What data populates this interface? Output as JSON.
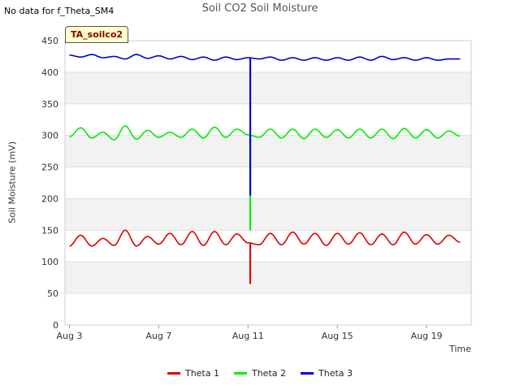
{
  "header": {
    "no_data_text": "No data for f_Theta_SM4",
    "title": "Soil CO2 Soil Moisture",
    "badge": "TA_soilco2"
  },
  "chart_data": {
    "type": "line",
    "title": "Soil CO2 Soil Moisture",
    "xlabel": "Time",
    "ylabel": "Soil Moisture (mV)",
    "xlim": [
      "2023-08-03",
      "2023-08-21"
    ],
    "ylim": [
      0,
      450
    ],
    "y_ticks": [
      0,
      50,
      100,
      150,
      200,
      250,
      300,
      350,
      400,
      450
    ],
    "x_ticks": [
      "Aug 3",
      "Aug 7",
      "Aug 11",
      "Aug 15",
      "Aug 19"
    ],
    "grid": true,
    "legend_position": "bottom",
    "x_day_numbers": [
      3,
      3.5,
      4,
      4.5,
      5,
      5.5,
      6,
      6.5,
      7,
      7.5,
      8,
      8.5,
      9,
      9.5,
      10,
      10.5,
      11,
      11.5,
      12,
      12.5,
      13,
      13.5,
      14,
      14.5,
      15,
      15.5,
      16,
      16.5,
      17,
      17.5,
      18,
      18.5,
      19,
      19.5,
      20,
      20.5
    ],
    "series": [
      {
        "name": "Theta 1",
        "color": "#dd0000",
        "values": [
          125,
          142,
          125,
          137,
          126,
          150,
          125,
          140,
          128,
          145,
          127,
          148,
          126,
          148,
          127,
          144,
          130,
          127,
          145,
          127,
          147,
          128,
          145,
          126,
          145,
          128,
          146,
          127,
          144,
          127,
          147,
          128,
          143,
          128,
          142,
          131
        ]
      },
      {
        "name": "Theta 2",
        "color": "#00ee00",
        "values": [
          298,
          312,
          296,
          305,
          293,
          315,
          294,
          308,
          297,
          305,
          297,
          310,
          296,
          313,
          297,
          310,
          301,
          297,
          310,
          296,
          310,
          295,
          310,
          297,
          309,
          296,
          310,
          296,
          310,
          295,
          311,
          296,
          309,
          296,
          307,
          299
        ]
      },
      {
        "name": "Theta 3",
        "color": "#0000cc",
        "values": [
          427,
          424,
          428,
          423,
          425,
          421,
          428,
          422,
          426,
          421,
          425,
          420,
          424,
          419,
          424,
          420,
          423,
          421,
          424,
          419,
          423,
          419,
          423,
          419,
          423,
          419,
          424,
          419,
          425,
          420,
          423,
          419,
          423,
          419,
          421,
          421
        ]
      }
    ],
    "annotations": [
      {
        "series": "Theta 1",
        "x_day_number": 11.1,
        "min_value": 65
      },
      {
        "series": "Theta 2",
        "x_day_number": 11.1,
        "min_value": 150
      },
      {
        "series": "Theta 3",
        "x_day_number": 11.1,
        "min_value": 205
      }
    ]
  }
}
